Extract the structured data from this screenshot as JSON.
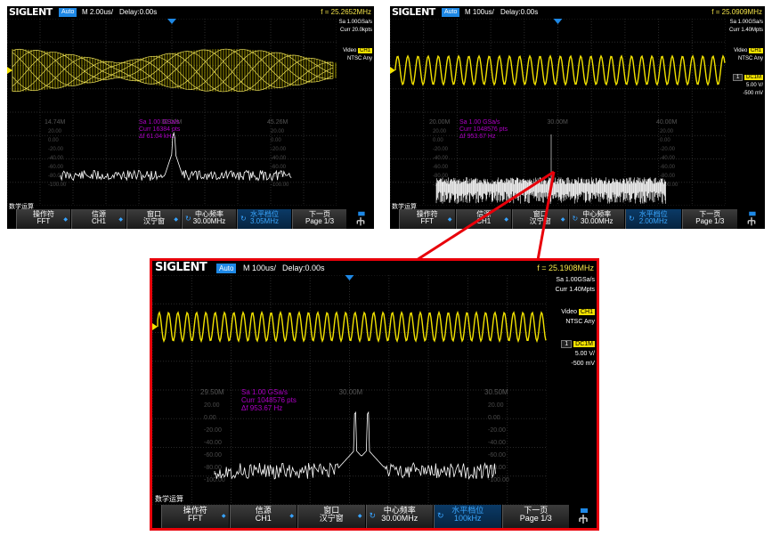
{
  "brand": "SIGLENT",
  "colors": {
    "trace_ch1": "#f2e200",
    "trace_fft": "#ffffff",
    "math_info": "#b000c8",
    "menu_accent": "#3aa7ff",
    "frame": "#e8000a"
  },
  "scope1": {
    "mode": "Auto",
    "timebase": "M 2.00us/",
    "delay": "Delay:0.00s",
    "freq": "f = 25.2652MHz",
    "sample_rate": "Sa 1.00GSa/s",
    "curr": "Curr 20.0kpts",
    "trig_type": "Video",
    "trig_std": "NTSC",
    "trig_src": "CH1",
    "trig_any": "Any",
    "grid_left": "14.74M",
    "grid_center": "30.00M",
    "grid_right": "45.26M",
    "fft_sa": "Sa 1.00 GSa/s",
    "fft_curr": "Curr 16384 pts",
    "fft_df": "Δf 61.04 kHz",
    "db_labels": [
      "20.00",
      "0.00",
      "-20.00",
      "-40.00",
      "-60.00",
      "-80.00",
      "-100.00"
    ],
    "math_label": "数学运算",
    "menu": [
      {
        "top": "操作符",
        "bottom": "FFT"
      },
      {
        "top": "信源",
        "bottom": "CH1"
      },
      {
        "top": "窗口",
        "bottom": "汉宁窗"
      },
      {
        "top": "中心频率",
        "bottom": "30.00MHz"
      },
      {
        "top": "水平档位",
        "bottom": "3.05MHz"
      },
      {
        "top": "下一页",
        "bottom": "Page 1/3"
      }
    ]
  },
  "scope2": {
    "mode": "Auto",
    "timebase": "M 100us/",
    "delay": "Delay:0.00s",
    "freq": "f = 25.0909MHz",
    "sample_rate": "Sa 1.00GSa/s",
    "curr": "Curr 1.40Mpts",
    "trig_type": "Video",
    "trig_std": "NTSC",
    "trig_src": "CH1",
    "trig_any": "Any",
    "ch_num": "1",
    "coupling": "DC1M",
    "vdiv": "5.00 V/",
    "offset": "-500 mV",
    "grid_left": "20.00M",
    "grid_center": "30.00M",
    "grid_right": "40.00M",
    "fft_sa": "Sa 1.00 GSa/s",
    "fft_curr": "Curr 1048576 pts",
    "fft_df": "Δf 953.67 Hz",
    "db_labels": [
      "20.00",
      "0.00",
      "-20.00",
      "-40.00",
      "-60.00",
      "-80.00",
      "-100.00"
    ],
    "math_label": "数学运算",
    "menu": [
      {
        "top": "操作符",
        "bottom": "FFT"
      },
      {
        "top": "信源",
        "bottom": "CH1"
      },
      {
        "top": "窗口",
        "bottom": "汉宁窗"
      },
      {
        "top": "中心频率",
        "bottom": "30.00MHz"
      },
      {
        "top": "水平档位",
        "bottom": "2.00MHz"
      },
      {
        "top": "下一页",
        "bottom": "Page 1/3"
      }
    ]
  },
  "scope3": {
    "mode": "Auto",
    "timebase": "M 100us/",
    "delay": "Delay:0.00s",
    "freq": "f = 25.1908MHz",
    "sample_rate": "Sa 1.00GSa/s",
    "curr": "Curr 1.40Mpts",
    "trig_type": "Video",
    "trig_std": "NTSC",
    "trig_src": "CH1",
    "trig_any": "Any",
    "ch_num": "1",
    "coupling": "DC1M",
    "vdiv": "5.00 V/",
    "offset": "-500 mV",
    "grid_left": "29.50M",
    "grid_center": "30.00M",
    "grid_right": "30.50M",
    "fft_sa": "Sa 1.00 GSa/s",
    "fft_curr": "Curr 1048576 pts",
    "fft_df": "Δf 953.67 Hz",
    "db_labels": [
      "20.00",
      "0.00",
      "-20.00",
      "-40.00",
      "-60.00",
      "-80.00",
      "-100.00"
    ],
    "math_label": "数学运算",
    "menu": [
      {
        "top": "操作符",
        "bottom": "FFT"
      },
      {
        "top": "信源",
        "bottom": "CH1"
      },
      {
        "top": "窗口",
        "bottom": "汉宁窗"
      },
      {
        "top": "中心频率",
        "bottom": "30.00MHz"
      },
      {
        "top": "水平档位",
        "bottom": "100kHz"
      },
      {
        "top": "下一页",
        "bottom": "Page 1/3"
      }
    ]
  }
}
